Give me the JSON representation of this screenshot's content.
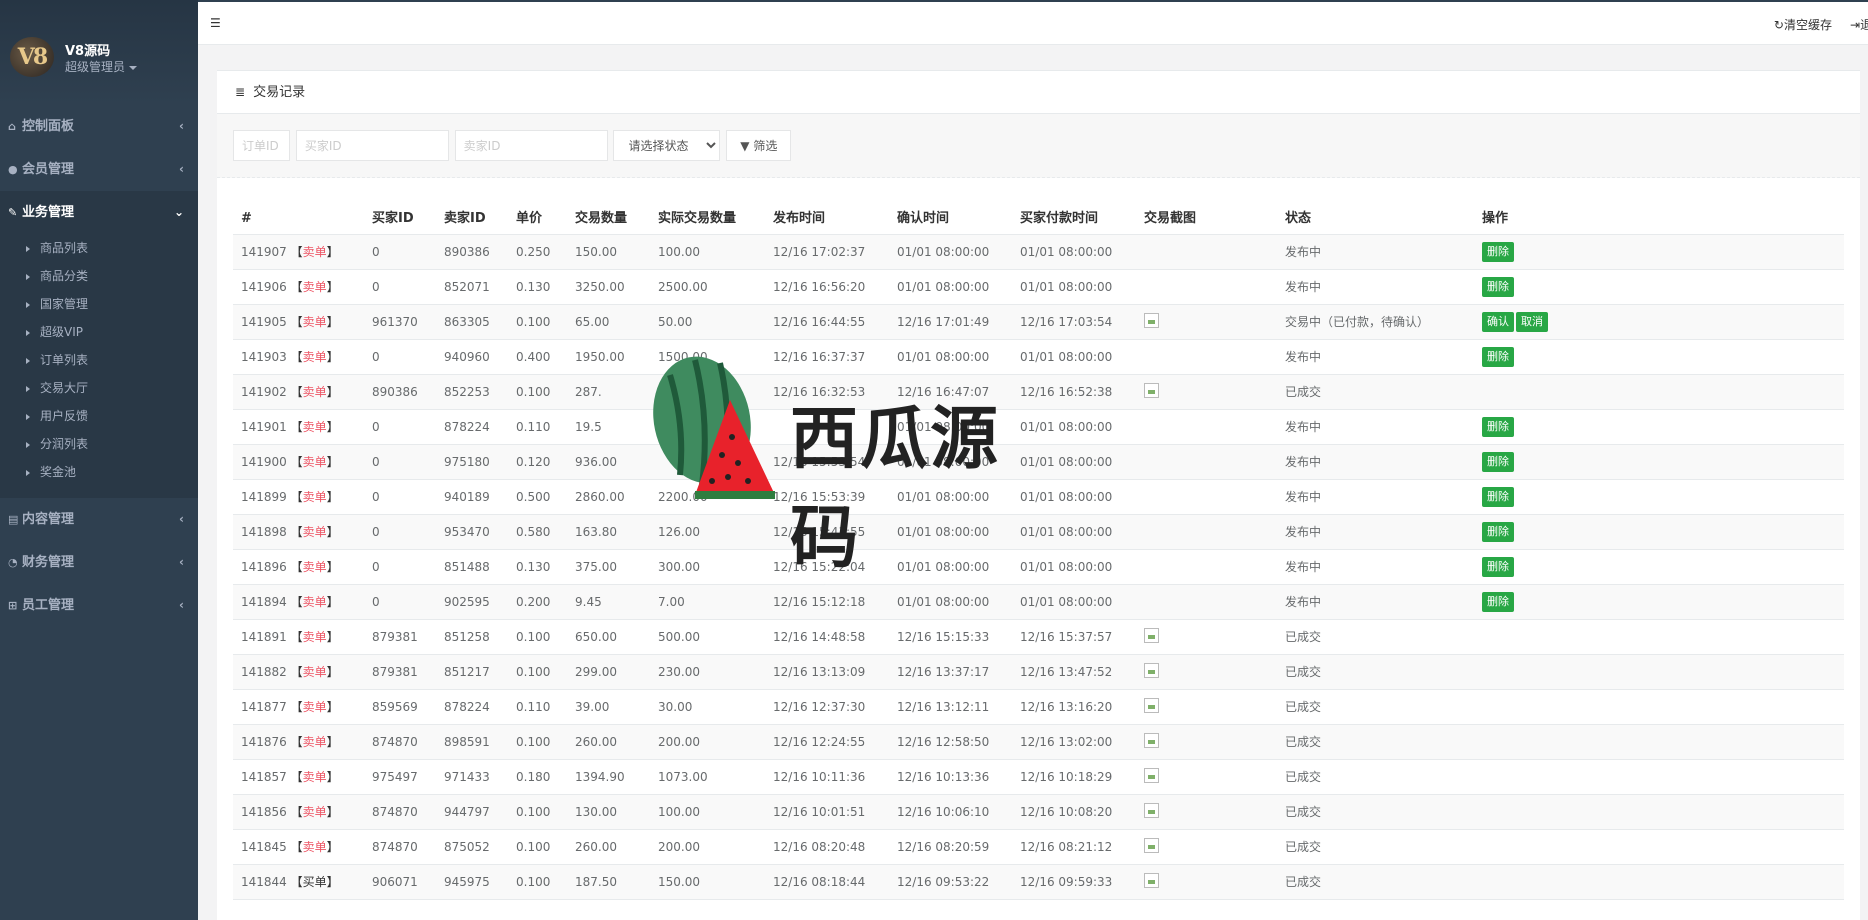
{
  "sidebar": {
    "brand": "V8源码",
    "logo_text": "V8",
    "role": "超级管理员",
    "menu": [
      {
        "label": "控制面板",
        "icon": "home-icon"
      },
      {
        "label": "会员管理",
        "icon": "user-icon"
      },
      {
        "label": "业务管理",
        "icon": "gavel-icon"
      },
      {
        "label": "内容管理",
        "icon": "book-icon"
      },
      {
        "label": "财务管理",
        "icon": "pie-chart-icon"
      },
      {
        "label": "员工管理",
        "icon": "sitemap-icon"
      }
    ],
    "submenu": [
      "商品列表",
      "商品分类",
      "国家管理",
      "超级VIP",
      "订单列表",
      "交易大厅",
      "用户反馈",
      "分润列表",
      "奖金池"
    ]
  },
  "topbar": {
    "clear_cache": "清空缓存",
    "exit_partial": "退"
  },
  "panel": {
    "title": "交易记录"
  },
  "filter": {
    "order_placeholder": "订单ID",
    "buyer_placeholder": "买家ID",
    "seller_placeholder": "卖家ID",
    "status_placeholder": "请选择状态",
    "filter_button": "筛选"
  },
  "table": {
    "columns": [
      "#",
      "买家ID",
      "卖家ID",
      "单价",
      "交易数量",
      "实际交易数量",
      "发布时间",
      "确认时间",
      "买家付款时间",
      "交易截图",
      "状态",
      "操作"
    ],
    "labels": {
      "sell": "卖单",
      "buy": "买单",
      "delete": "删除",
      "confirm": "确认",
      "cancel": "取消"
    },
    "rows": [
      {
        "id": "141907",
        "type": "卖单",
        "buyer": "0",
        "seller": "890386",
        "price": "0.250",
        "qty": "150.00",
        "actual": "100.00",
        "publish": "12/16 17:02:37",
        "confirm": "01/01 08:00:00",
        "paid": "01/01 08:00:00",
        "shot": false,
        "status": "发布中",
        "actions": [
          "删除"
        ]
      },
      {
        "id": "141906",
        "type": "卖单",
        "buyer": "0",
        "seller": "852071",
        "price": "0.130",
        "qty": "3250.00",
        "actual": "2500.00",
        "publish": "12/16 16:56:20",
        "confirm": "01/01 08:00:00",
        "paid": "01/01 08:00:00",
        "shot": false,
        "status": "发布中",
        "actions": [
          "删除"
        ]
      },
      {
        "id": "141905",
        "type": "卖单",
        "buyer": "961370",
        "seller": "863305",
        "price": "0.100",
        "qty": "65.00",
        "actual": "50.00",
        "publish": "12/16 16:44:55",
        "confirm": "12/16 17:01:49",
        "paid": "12/16 17:03:54",
        "shot": true,
        "status": "交易中（已付款，待确认）",
        "actions": [
          "确认",
          "取消"
        ]
      },
      {
        "id": "141903",
        "type": "卖单",
        "buyer": "0",
        "seller": "940960",
        "price": "0.400",
        "qty": "1950.00",
        "actual": "1500.00",
        "publish": "12/16 16:37:37",
        "confirm": "01/01 08:00:00",
        "paid": "01/01 08:00:00",
        "shot": false,
        "status": "发布中",
        "actions": [
          "删除"
        ]
      },
      {
        "id": "141902",
        "type": "卖单",
        "buyer": "890386",
        "seller": "852253",
        "price": "0.100",
        "qty": "287.",
        "actual": "",
        "publish": "12/16 16:32:53",
        "confirm": "12/16 16:47:07",
        "paid": "12/16 16:52:38",
        "shot": true,
        "status": "已成交",
        "actions": []
      },
      {
        "id": "141901",
        "type": "卖单",
        "buyer": "0",
        "seller": "878224",
        "price": "0.110",
        "qty": "19.5",
        "actual": "",
        "publish": "",
        "confirm": "01/01 08:00:00",
        "paid": "01/01 08:00:00",
        "shot": false,
        "status": "发布中",
        "actions": [
          "删除"
        ]
      },
      {
        "id": "141900",
        "type": "卖单",
        "buyer": "0",
        "seller": "975180",
        "price": "0.120",
        "qty": "936.00",
        "actual": "",
        "publish": "12/16 15:53:54",
        "confirm": "01/01 08:00:00",
        "paid": "01/01 08:00:00",
        "shot": false,
        "status": "发布中",
        "actions": [
          "删除"
        ]
      },
      {
        "id": "141899",
        "type": "卖单",
        "buyer": "0",
        "seller": "940189",
        "price": "0.500",
        "qty": "2860.00",
        "actual": "2200.00",
        "publish": "12/16 15:53:39",
        "confirm": "01/01 08:00:00",
        "paid": "01/01 08:00:00",
        "shot": false,
        "status": "发布中",
        "actions": [
          "删除"
        ]
      },
      {
        "id": "141898",
        "type": "卖单",
        "buyer": "0",
        "seller": "953470",
        "price": "0.580",
        "qty": "163.80",
        "actual": "126.00",
        "publish": "12/16 15:41:55",
        "confirm": "01/01 08:00:00",
        "paid": "01/01 08:00:00",
        "shot": false,
        "status": "发布中",
        "actions": [
          "删除"
        ]
      },
      {
        "id": "141896",
        "type": "卖单",
        "buyer": "0",
        "seller": "851488",
        "price": "0.130",
        "qty": "375.00",
        "actual": "300.00",
        "publish": "12/16 15:22:04",
        "confirm": "01/01 08:00:00",
        "paid": "01/01 08:00:00",
        "shot": false,
        "status": "发布中",
        "actions": [
          "删除"
        ]
      },
      {
        "id": "141894",
        "type": "卖单",
        "buyer": "0",
        "seller": "902595",
        "price": "0.200",
        "qty": "9.45",
        "actual": "7.00",
        "publish": "12/16 15:12:18",
        "confirm": "01/01 08:00:00",
        "paid": "01/01 08:00:00",
        "shot": false,
        "status": "发布中",
        "actions": [
          "删除"
        ]
      },
      {
        "id": "141891",
        "type": "卖单",
        "buyer": "879381",
        "seller": "851258",
        "price": "0.100",
        "qty": "650.00",
        "actual": "500.00",
        "publish": "12/16 14:48:58",
        "confirm": "12/16 15:15:33",
        "paid": "12/16 15:37:57",
        "shot": true,
        "status": "已成交",
        "actions": []
      },
      {
        "id": "141882",
        "type": "卖单",
        "buyer": "879381",
        "seller": "851217",
        "price": "0.100",
        "qty": "299.00",
        "actual": "230.00",
        "publish": "12/16 13:13:09",
        "confirm": "12/16 13:37:17",
        "paid": "12/16 13:47:52",
        "shot": true,
        "status": "已成交",
        "actions": []
      },
      {
        "id": "141877",
        "type": "卖单",
        "buyer": "859569",
        "seller": "878224",
        "price": "0.110",
        "qty": "39.00",
        "actual": "30.00",
        "publish": "12/16 12:37:30",
        "confirm": "12/16 13:12:11",
        "paid": "12/16 13:16:20",
        "shot": true,
        "status": "已成交",
        "actions": []
      },
      {
        "id": "141876",
        "type": "卖单",
        "buyer": "874870",
        "seller": "898591",
        "price": "0.100",
        "qty": "260.00",
        "actual": "200.00",
        "publish": "12/16 12:24:55",
        "confirm": "12/16 12:58:50",
        "paid": "12/16 13:02:00",
        "shot": true,
        "status": "已成交",
        "actions": []
      },
      {
        "id": "141857",
        "type": "卖单",
        "buyer": "975497",
        "seller": "971433",
        "price": "0.180",
        "qty": "1394.90",
        "actual": "1073.00",
        "publish": "12/16 10:11:36",
        "confirm": "12/16 10:13:36",
        "paid": "12/16 10:18:29",
        "shot": true,
        "status": "已成交",
        "actions": []
      },
      {
        "id": "141856",
        "type": "卖单",
        "buyer": "874870",
        "seller": "944797",
        "price": "0.100",
        "qty": "130.00",
        "actual": "100.00",
        "publish": "12/16 10:01:51",
        "confirm": "12/16 10:06:10",
        "paid": "12/16 10:08:20",
        "shot": true,
        "status": "已成交",
        "actions": []
      },
      {
        "id": "141845",
        "type": "卖单",
        "buyer": "874870",
        "seller": "875052",
        "price": "0.100",
        "qty": "260.00",
        "actual": "200.00",
        "publish": "12/16 08:20:48",
        "confirm": "12/16 08:20:59",
        "paid": "12/16 08:21:12",
        "shot": true,
        "status": "已成交",
        "actions": []
      },
      {
        "id": "141844",
        "type": "买单",
        "buyer": "906071",
        "seller": "945975",
        "price": "0.100",
        "qty": "187.50",
        "actual": "150.00",
        "publish": "12/16 08:18:44",
        "confirm": "12/16 09:53:22",
        "paid": "12/16 09:59:33",
        "shot": true,
        "status": "已成交",
        "actions": []
      }
    ]
  },
  "watermark": {
    "text": "西瓜源码"
  }
}
